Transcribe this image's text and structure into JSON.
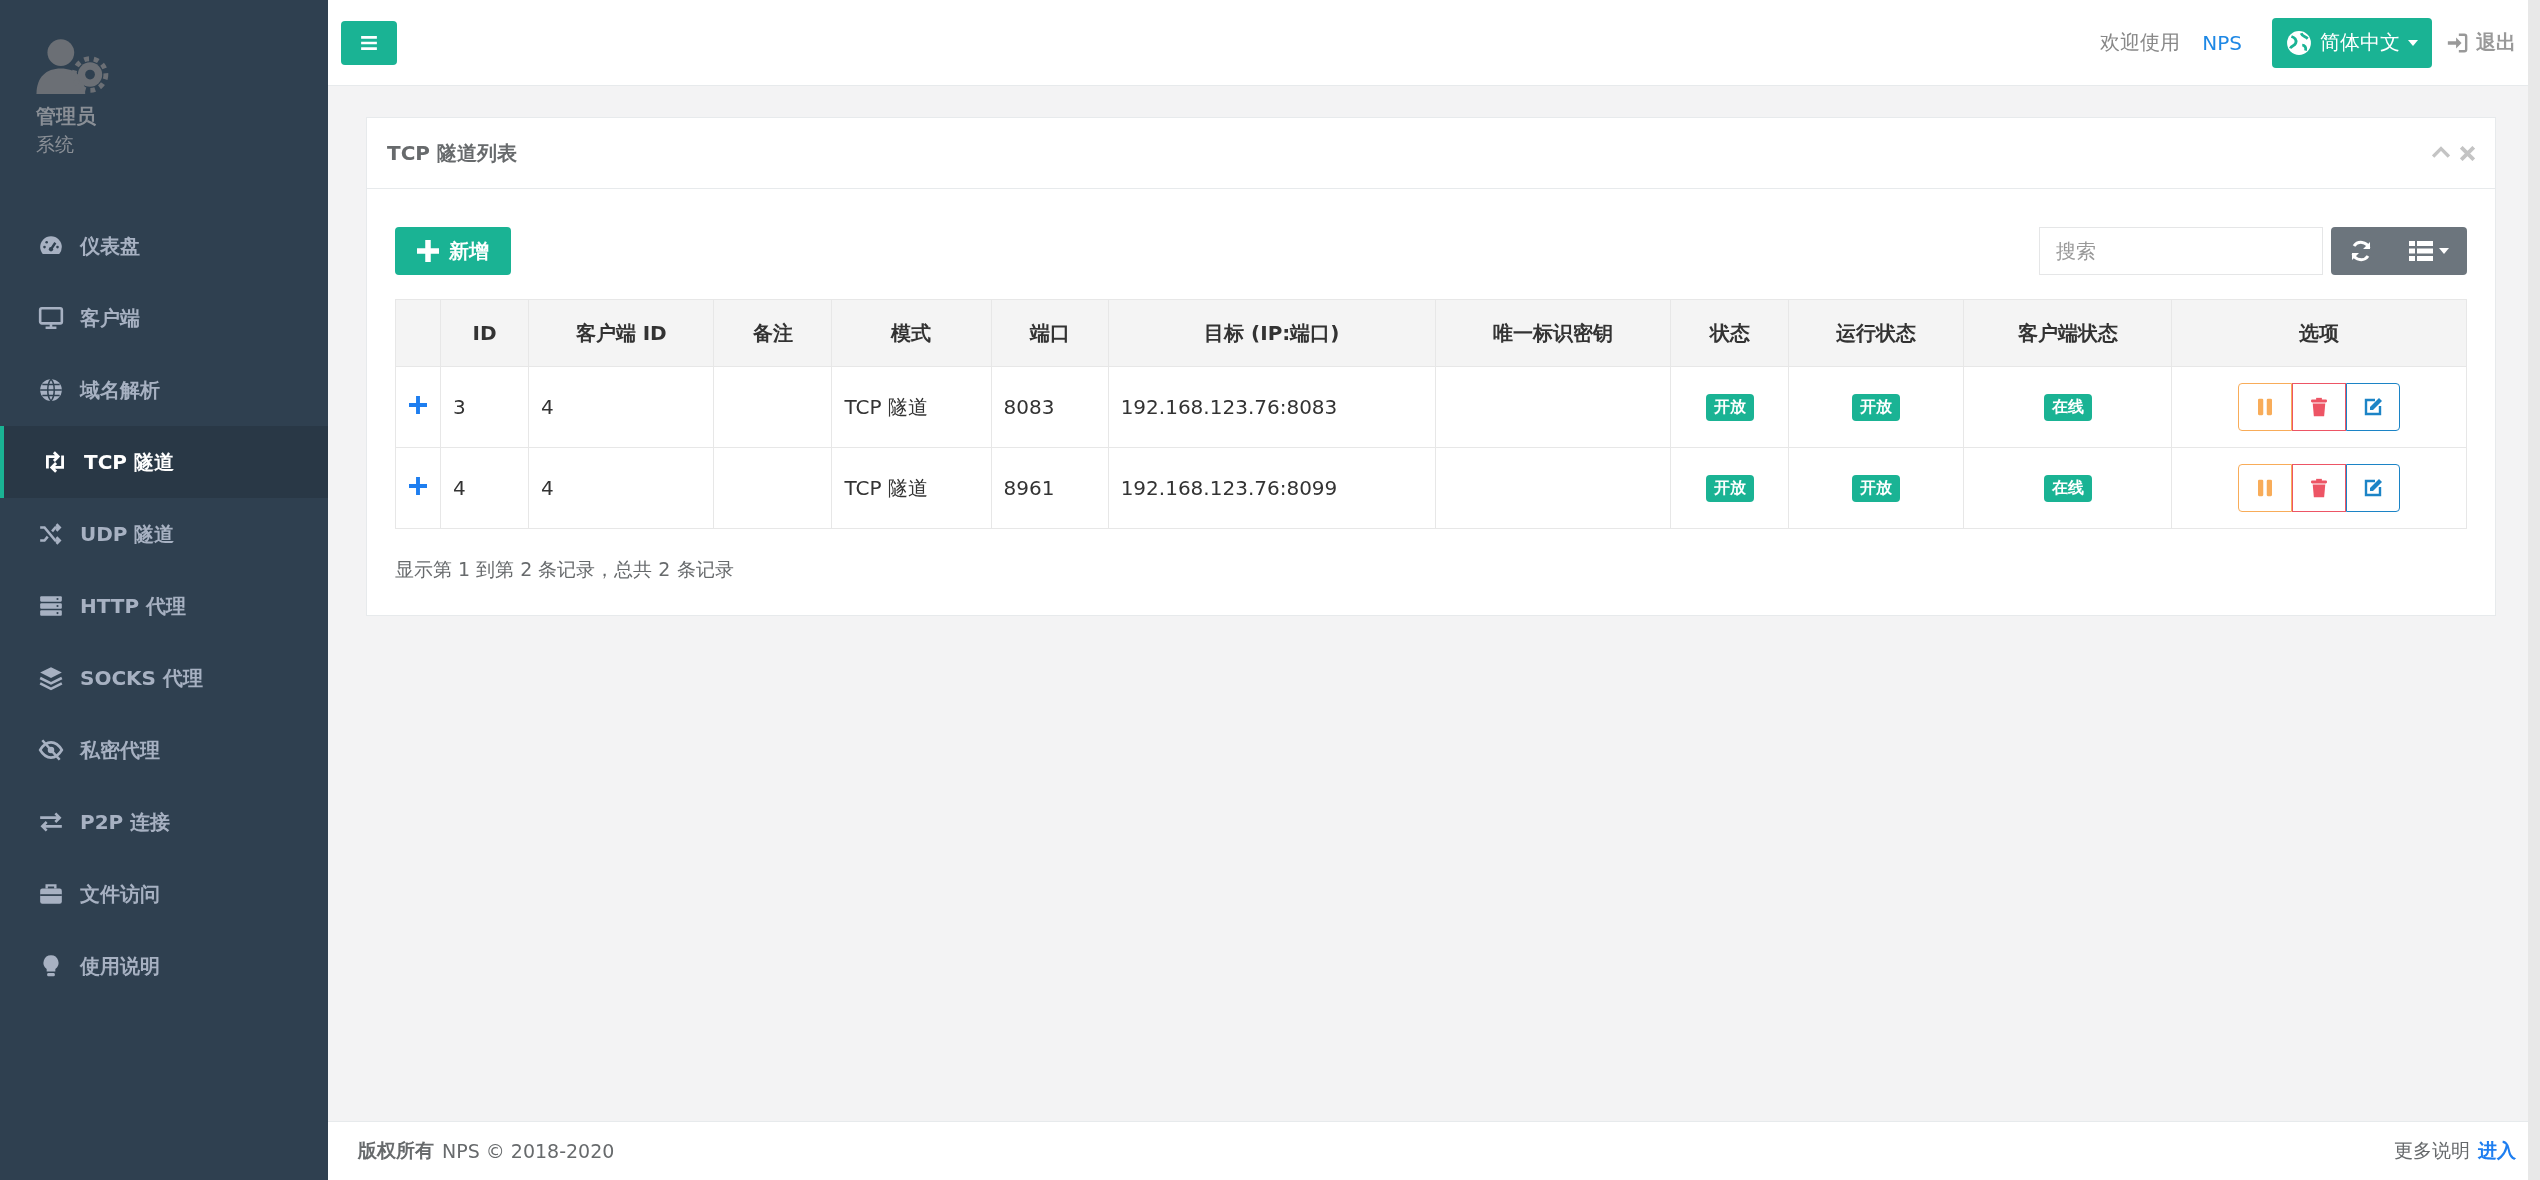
{
  "sidebar": {
    "user_name": "管理员",
    "user_role": "系统",
    "items": [
      {
        "label": "仪表盘",
        "selected": false
      },
      {
        "label": "客户端",
        "selected": false
      },
      {
        "label": "域名解析",
        "selected": false
      },
      {
        "label": "TCP 隧道",
        "selected": true
      },
      {
        "label": "UDP 隧道",
        "selected": false
      },
      {
        "label": "HTTP 代理",
        "selected": false
      },
      {
        "label": "SOCKS 代理",
        "selected": false
      },
      {
        "label": "私密代理",
        "selected": false
      },
      {
        "label": "P2P 连接",
        "selected": false
      },
      {
        "label": "文件访问",
        "selected": false
      },
      {
        "label": "使用说明",
        "selected": false
      }
    ]
  },
  "topbar": {
    "welcome": "欢迎使用",
    "brand": "NPS",
    "language": "简体中文",
    "logout": "退出"
  },
  "panel": {
    "title": "TCP 隧道列表",
    "add_button": "新增",
    "search": {
      "placeholder": "搜索"
    },
    "table": {
      "columns": [
        "ID",
        "客户端 ID",
        "备注",
        "模式",
        "端口",
        "目标 (IP:端口)",
        "唯一标识密钥",
        "状态",
        "运行状态",
        "客户端状态",
        "选项"
      ],
      "rows": [
        {
          "id": "3",
          "client_id": "4",
          "mode": "TCP 隧道",
          "port": "8083",
          "target": "192.168.123.76:8083",
          "status": "开放",
          "run_status": "开放",
          "client_status": "在线"
        },
        {
          "id": "4",
          "client_id": "4",
          "mode": "TCP 隧道",
          "port": "8961",
          "target": "192.168.123.76:8099",
          "status": "开放",
          "run_status": "开放",
          "client_status": "在线"
        }
      ]
    },
    "summary": "显示第 1 到第 2 条记录，总共 2 条记录"
  },
  "footer": {
    "copyright_label": "版权所有",
    "copyright": "NPS © 2018-2020",
    "more": "更多说明",
    "link": "进入"
  }
}
